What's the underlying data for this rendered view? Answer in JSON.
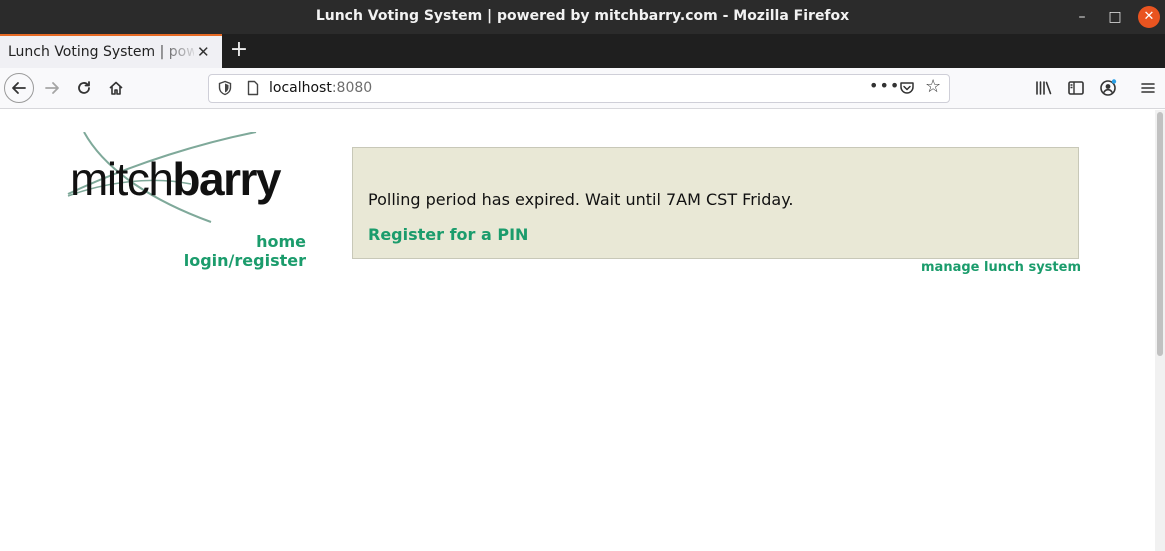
{
  "window": {
    "title": "Lunch Voting System | powered by mitchbarry.com - Mozilla Firefox",
    "controls": {
      "minimize": "–",
      "maximize": "□",
      "close": "✕"
    }
  },
  "tabs": [
    {
      "label": "Lunch Voting System | powered by mitchbarry.com",
      "active": true,
      "close": "✕"
    }
  ],
  "new_tab_label": "+",
  "navbar": {
    "back_icon": "back-arrow-icon",
    "forward_icon": "forward-arrow-icon",
    "reload_icon": "reload-icon",
    "home_icon": "home-icon",
    "url_host": "localhost",
    "url_port": ":8080",
    "page_actions": "•••",
    "star": "☆"
  },
  "page": {
    "logo": {
      "regular": "mitch",
      "bold": "barry"
    },
    "nav_links": [
      "home",
      "login/register"
    ],
    "notice": {
      "message": "Polling period has expired. Wait until 7AM CST Friday.",
      "register_link": "Register for a PIN"
    },
    "manage_link": "manage lunch system"
  },
  "colors": {
    "link": "#1b9c6c",
    "notice_bg": "#e9e8d6",
    "titlebar_bg": "#2b2b2b",
    "tab_accent": "#e66a25",
    "close_button": "#e95420"
  }
}
